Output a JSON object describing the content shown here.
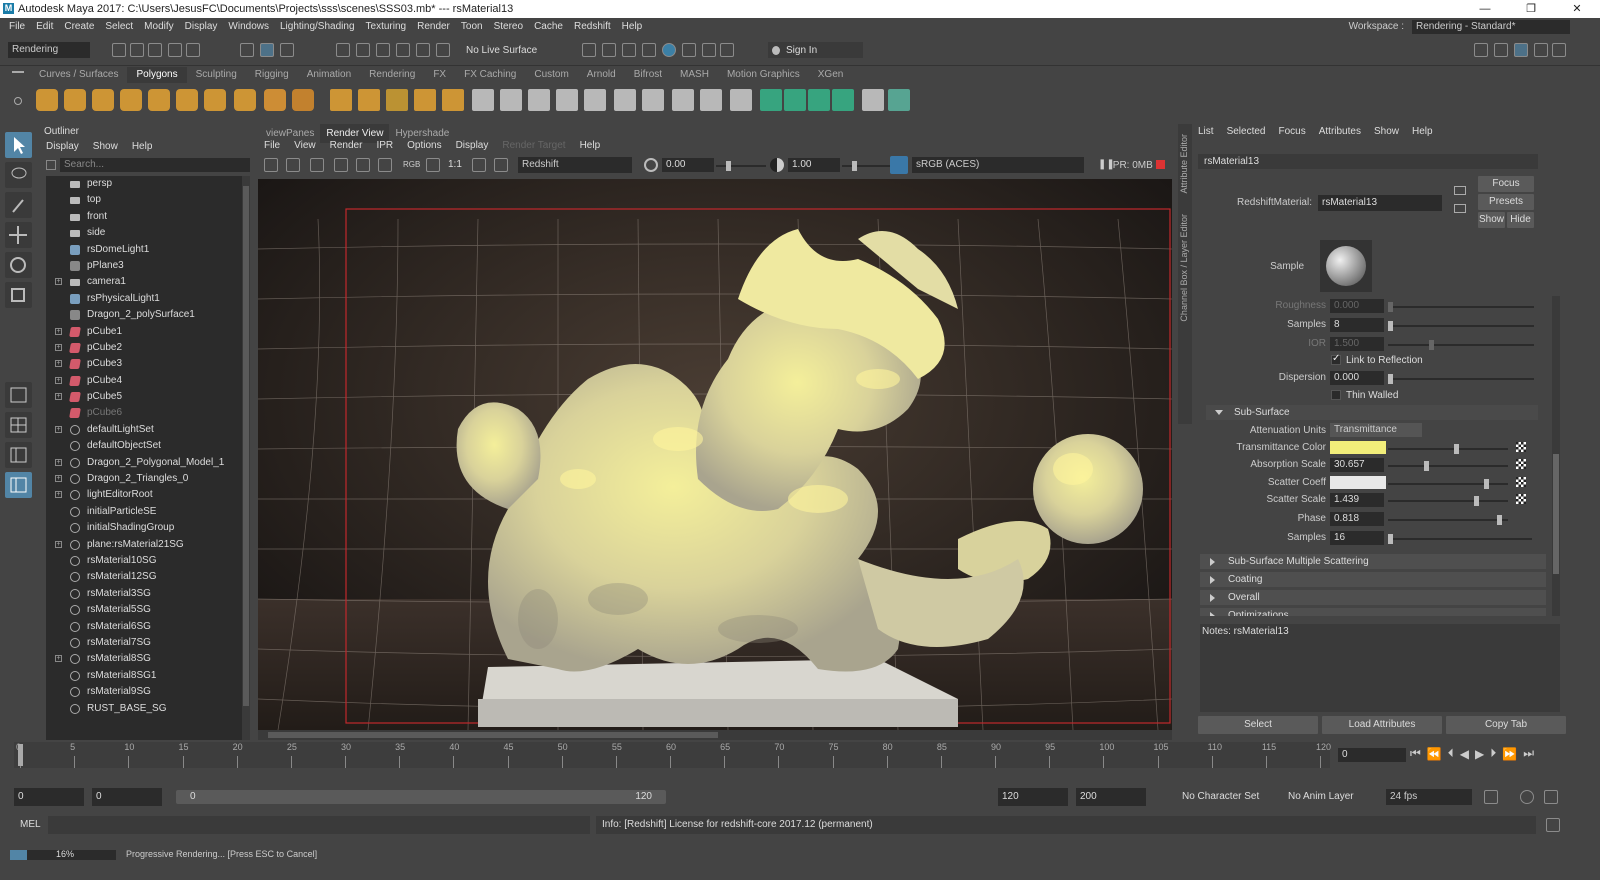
{
  "titlebar": {
    "title": "Autodesk Maya 2017: C:\\Users\\JesusFC\\Documents\\Projects\\sss\\scenes\\SSS03.mb*   ---   rsMaterial13",
    "min": "—",
    "max": "❐",
    "close": "✕"
  },
  "menubar": [
    "File",
    "Edit",
    "Create",
    "Select",
    "Modify",
    "Display",
    "Windows",
    "Lighting/Shading",
    "Texturing",
    "Render",
    "Toon",
    "Stereo",
    "Cache",
    "Redshift",
    "Help"
  ],
  "workspace": {
    "label": "Workspace :",
    "value": "Rendering - Standard*"
  },
  "statusline": {
    "menuset": "Rendering",
    "live_surface": "No Live Surface",
    "sign_in": "Sign In"
  },
  "shelf": {
    "tabs": [
      "Curves / Surfaces",
      "Polygons",
      "Sculpting",
      "Rigging",
      "Animation",
      "Rendering",
      "FX",
      "FX Caching",
      "Custom",
      "Arnold",
      "Bifrost",
      "MASH",
      "Motion Graphics",
      "XGen"
    ],
    "active": "Polygons"
  },
  "outliner": {
    "title": "Outliner",
    "menu": [
      "Display",
      "Show",
      "Help"
    ],
    "search_placeholder": "Search...",
    "items": [
      {
        "label": "persp",
        "type": "cam",
        "exp": false
      },
      {
        "label": "top",
        "type": "cam",
        "exp": false
      },
      {
        "label": "front",
        "type": "cam",
        "exp": false
      },
      {
        "label": "side",
        "type": "cam",
        "exp": false
      },
      {
        "label": "rsDomeLight1",
        "type": "lt",
        "exp": false
      },
      {
        "label": "pPlane3",
        "type": "mesh2",
        "exp": false
      },
      {
        "label": "camera1",
        "type": "cam",
        "exp": true
      },
      {
        "label": "rsPhysicalLight1",
        "type": "lt",
        "exp": false
      },
      {
        "label": "Dragon_2_polySurface1",
        "type": "mesh2",
        "exp": false
      },
      {
        "label": "pCube1",
        "type": "mesh",
        "exp": true
      },
      {
        "label": "pCube2",
        "type": "mesh",
        "exp": true
      },
      {
        "label": "pCube3",
        "type": "mesh",
        "exp": true
      },
      {
        "label": "pCube4",
        "type": "mesh",
        "exp": true
      },
      {
        "label": "pCube5",
        "type": "mesh",
        "exp": true
      },
      {
        "label": "pCube6",
        "type": "mesh",
        "exp": false,
        "dim": true
      },
      {
        "label": "defaultLightSet",
        "type": "sg",
        "exp": true
      },
      {
        "label": "defaultObjectSet",
        "type": "sg",
        "exp": false
      },
      {
        "label": "Dragon_2_Polygonal_Model_1",
        "type": "sg",
        "exp": true
      },
      {
        "label": "Dragon_2_Triangles_0",
        "type": "sg",
        "exp": true
      },
      {
        "label": "lightEditorRoot",
        "type": "sg",
        "exp": true
      },
      {
        "label": "initialParticleSE",
        "type": "sg",
        "exp": false
      },
      {
        "label": "initialShadingGroup",
        "type": "sg",
        "exp": false
      },
      {
        "label": "plane:rsMaterial21SG",
        "type": "sg",
        "exp": true
      },
      {
        "label": "rsMaterial10SG",
        "type": "sg",
        "exp": false
      },
      {
        "label": "rsMaterial12SG",
        "type": "sg",
        "exp": false
      },
      {
        "label": "rsMaterial3SG",
        "type": "sg",
        "exp": false
      },
      {
        "label": "rsMaterial5SG",
        "type": "sg",
        "exp": false
      },
      {
        "label": "rsMaterial6SG",
        "type": "sg",
        "exp": false
      },
      {
        "label": "rsMaterial7SG",
        "type": "sg",
        "exp": false
      },
      {
        "label": "rsMaterial8SG",
        "type": "sg",
        "exp": true
      },
      {
        "label": "rsMaterial8SG1",
        "type": "sg",
        "exp": false
      },
      {
        "label": "rsMaterial9SG",
        "type": "sg",
        "exp": false
      },
      {
        "label": "RUST_BASE_SG",
        "type": "sg",
        "exp": false
      }
    ]
  },
  "renderview": {
    "tabs": [
      "viewPanes",
      "Render View",
      "Hypershade"
    ],
    "active_tab": "Render View",
    "menu": [
      "File",
      "View",
      "Render",
      "IPR",
      "Options",
      "Display",
      "Render Target",
      "Help"
    ],
    "renderer": "Redshift",
    "exposure": "0.00",
    "gamma": "1.00",
    "ratio": "1:1",
    "rgb": "RGB",
    "colorspace": "sRGB (ACES)",
    "ipr_mem": "IPR: 0MB"
  },
  "attr_editor": {
    "side_tabs": [
      "Attribute Editor",
      "Channel Box / Layer Editor"
    ],
    "menu": [
      "List",
      "Selected",
      "Focus",
      "Attributes",
      "Show",
      "Help"
    ],
    "tab": "rsMaterial13",
    "material_label": "RedshiftMaterial:",
    "material_name": "rsMaterial13",
    "focus": "Focus",
    "presets": "Presets",
    "show": "Show",
    "hide": "Hide",
    "sample_label": "Sample",
    "refl": [
      {
        "label": "Roughness",
        "value": "0.000",
        "dim": true,
        "level": 0.0
      },
      {
        "label": "Samples",
        "value": "8",
        "dim": false,
        "level": 0.0
      },
      {
        "label": "IOR",
        "value": "1.500",
        "dim": true,
        "level": 0.28
      },
      {
        "label": "Dispersion",
        "value": "0.000",
        "dim": false,
        "level": 0.0
      }
    ],
    "link_reflection": "Link to Reflection",
    "thin_walled": "Thin Walled",
    "subsurface_label": "Sub-Surface",
    "atten_units_label": "Attenuation Units",
    "atten_units": "Transmittance",
    "ss": [
      {
        "label": "Transmittance Color",
        "value": "",
        "color": "#f2ee7a",
        "level": 0.55
      },
      {
        "label": "Absorption Scale",
        "value": "30.657",
        "level": 0.3
      },
      {
        "label": "Scatter Coeff",
        "value": "",
        "color": "#e8e8e8",
        "level": 0.8
      },
      {
        "label": "Scatter Scale",
        "value": "1.439",
        "level": 0.72
      },
      {
        "label": "Phase",
        "value": "0.818",
        "level": 0.91
      },
      {
        "label": "Samples",
        "value": "16",
        "level": 0.0
      }
    ],
    "sections": [
      "Sub-Surface Multiple Scattering",
      "Coating",
      "Overall",
      "Optimizations"
    ],
    "notes": "Notes:  rsMaterial13",
    "bottom_buttons": [
      "Select",
      "Load Attributes",
      "Copy Tab"
    ]
  },
  "timeline": {
    "ticks": [
      "0",
      "5",
      "10",
      "15",
      "20",
      "25",
      "30",
      "35",
      "40",
      "45",
      "50",
      "55",
      "60",
      "65",
      "70",
      "75",
      "80",
      "85",
      "90",
      "95",
      "100",
      "105",
      "110",
      "115",
      "120"
    ],
    "current": "0"
  },
  "range": {
    "start": "0",
    "playstart": "0",
    "slider_start": "0",
    "slider_end": "120",
    "playend": "120",
    "end": "200",
    "char_set": "No Character Set",
    "anim_layer": "No Anim Layer",
    "fps": "24 fps"
  },
  "cmd": {
    "lang": "MEL",
    "info": "Info:  [Redshift] License for redshift-core 2017.12 (permanent)"
  },
  "help": {
    "percent": "16%",
    "text": "Progressive Rendering... [Press ESC to Cancel]",
    "progress": 0.16
  },
  "colors": {
    "accent": "#5285a6",
    "render_border": "#c0282c",
    "stop": "#d33"
  }
}
